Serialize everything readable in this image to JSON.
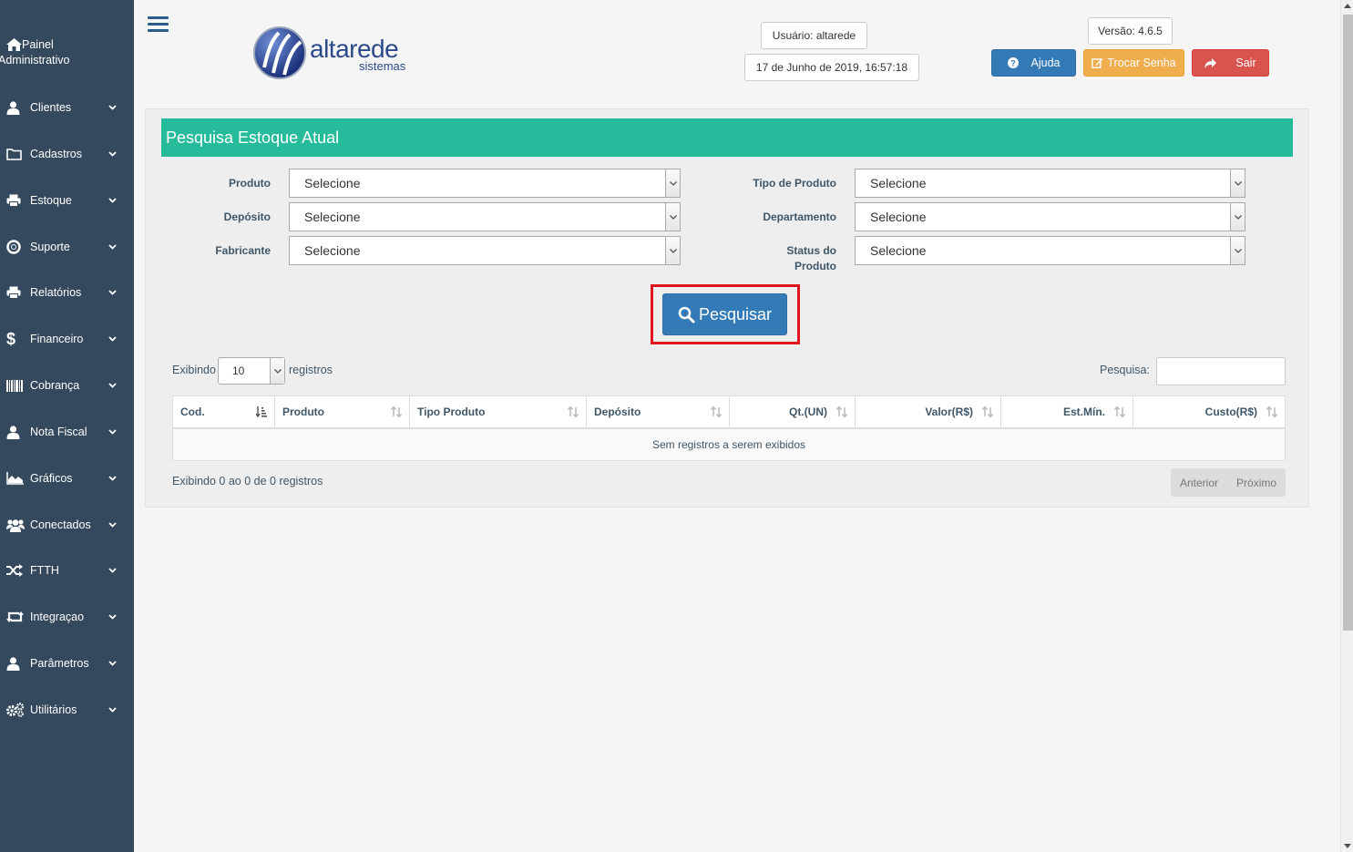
{
  "sidebar": {
    "header": {
      "label_line1": "Painel",
      "label_line2": "Administrativo",
      "icon": "home-icon"
    },
    "items": [
      {
        "label": "Clientes",
        "icon": "user-icon"
      },
      {
        "label": "Cadastros",
        "icon": "folder-icon"
      },
      {
        "label": "Estoque",
        "icon": "print-icon"
      },
      {
        "label": "Suporte",
        "icon": "lifering-icon"
      },
      {
        "label": "Relatórios",
        "icon": "print-icon"
      },
      {
        "label": "Financeiro",
        "icon": "dollar-icon"
      },
      {
        "label": "Cobrança",
        "icon": "barcode-icon"
      },
      {
        "label": "Nota Fiscal",
        "icon": "user-icon"
      },
      {
        "label": "Gráficos",
        "icon": "area-chart-icon"
      },
      {
        "label": "Conectados",
        "icon": "users-icon"
      },
      {
        "label": "FTTH",
        "icon": "random-icon"
      },
      {
        "label": "Integraçao",
        "icon": "retweet-icon"
      },
      {
        "label": "Parâmetros",
        "icon": "user-icon"
      },
      {
        "label": "Utilitários",
        "icon": "cogs-icon"
      }
    ]
  },
  "header": {
    "logo_text": "altarede",
    "logo_sub": "sistemas",
    "user": "Usuário: altarede",
    "datetime": "17 de Junho de 2019, 16:57:18",
    "version": "Versão: 4.6.5",
    "buttons": {
      "help": "Ajuda",
      "change_password": "Trocar Senha",
      "logout": "Sair"
    }
  },
  "form": {
    "title": "Pesquisa Estoque Atual",
    "fields": {
      "produto": {
        "label": "Produto",
        "value": "Selecione"
      },
      "deposito": {
        "label": "Depósito",
        "value": "Selecione"
      },
      "fabricante": {
        "label": "Fabricante",
        "value": "Selecione"
      },
      "tipo_produto": {
        "label": "Tipo de Produto",
        "value": "Selecione"
      },
      "departamento": {
        "label": "Departamento",
        "value": "Selecione"
      },
      "status_line1": "Status do",
      "status_line2": "Produto",
      "status_value": "Selecione"
    },
    "search_button": "Pesquisar"
  },
  "table": {
    "length_prefix": "Exibindo",
    "length_value": "10",
    "length_suffix": "registros",
    "search_label": "Pesquisa:",
    "search_value": "",
    "columns": [
      "Cod.",
      "Produto",
      "Tipo Produto",
      "Depósito",
      "Qt.(UN)",
      "Valor(R$)",
      "Est.Mín.",
      "Custo(R$)"
    ],
    "empty_message": "Sem registros a serem exibidos",
    "info": "Exibindo 0 ao 0 de 0 registros",
    "prev": "Anterior",
    "next": "Próximo"
  },
  "colors": {
    "sidebar": "#34495e",
    "title_bar": "#26bb9b",
    "primary": "#337ab7",
    "warning": "#f0ad4e",
    "danger": "#d9534f",
    "highlight": "#e3141f"
  }
}
